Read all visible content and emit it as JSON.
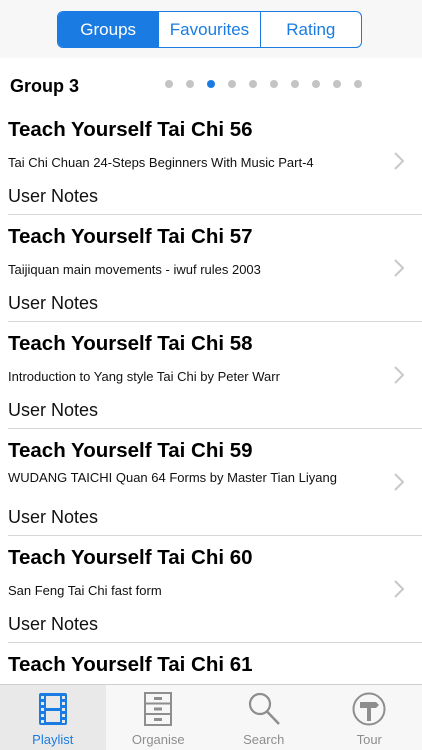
{
  "segments": {
    "items": [
      {
        "label": "Groups",
        "active": true
      },
      {
        "label": "Favourites",
        "active": false
      },
      {
        "label": "Rating",
        "active": false
      }
    ]
  },
  "group": {
    "title": "Group 3",
    "page_count": 10,
    "active_page": 3
  },
  "rows": [
    {
      "title": "Teach Yourself Tai Chi 56",
      "subtitle": "Tai Chi Chuan 24-Steps Beginners With Music Part-4",
      "notes": "User Notes"
    },
    {
      "title": "Teach Yourself Tai Chi 57",
      "subtitle": "Taijiquan main movements - iwuf rules 2003",
      "notes": "User Notes"
    },
    {
      "title": "Teach Yourself Tai Chi 58",
      "subtitle": "Introduction to Yang style Tai Chi by Peter Warr",
      "notes": "User Notes"
    },
    {
      "title": "Teach Yourself Tai Chi 59",
      "subtitle": "WUDANG TAICHI Quan 64 Forms by Master Tian Liyang",
      "notes": "User Notes"
    },
    {
      "title": "Teach Yourself Tai Chi 60",
      "subtitle": "San Feng Tai Chi fast form",
      "notes": "User Notes"
    },
    {
      "title": "Teach Yourself Tai Chi 61"
    }
  ],
  "tabbar": {
    "items": [
      {
        "label": "Playlist",
        "icon": "film-icon",
        "active": true
      },
      {
        "label": "Organise",
        "icon": "cabinet-icon",
        "active": false
      },
      {
        "label": "Search",
        "icon": "magnifier-icon",
        "active": false
      },
      {
        "label": "Tour",
        "icon": "signpost-icon",
        "active": false
      }
    ]
  },
  "colors": {
    "accent": "#1a7ce3",
    "inactive_tab": "#8e8e8e",
    "dot_inactive": "#c4c4c4"
  }
}
